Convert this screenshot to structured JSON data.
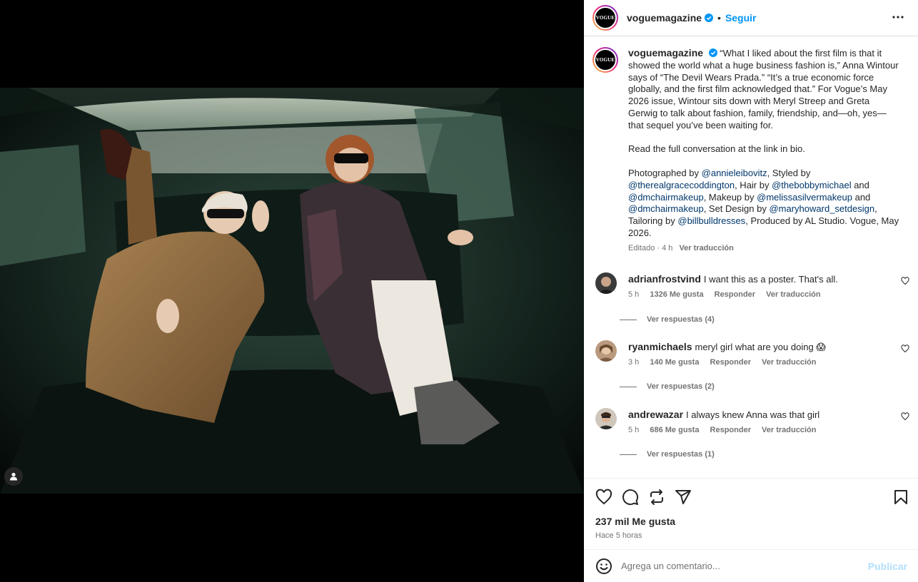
{
  "post": {
    "username": "voguemagazine",
    "avatar_text": "VOGUE",
    "follow_label": "Seguir",
    "separator": "•"
  },
  "caption": {
    "username": "voguemagazine",
    "p1": "“What I liked about the first film is that it showed the world what a huge business fashion is,” Anna Wintour says of “The Devil Wears Prada.” “It’s a true economic force globally, and the first film acknowledged that.” For Vogue’s May 2026 issue, Wintour sits down with Meryl Streep and Greta Gerwig to talk about fashion, family, friendship, and—oh, yes—that sequel you’ve been waiting for.",
    "p2": "Read the full conversation at the link in bio.",
    "p3": {
      "t1": "Photographed by ",
      "m1": "@annieleibovitz",
      "t2": ", Styled by ",
      "m2": "@therealgracecoddington",
      "t3": ", Hair by ",
      "m3": "@thebobbymichael",
      "t4": " and ",
      "m4": "@dmchairmakeup",
      "t5": ", Makeup by ",
      "m5": "@melissasilvermakeup",
      "t6": " and ",
      "m6": "@dmchairmakeup",
      "t7": ", Set Design by ",
      "m7": "@maryhoward_setdesign",
      "t8": ", Tailoring by ",
      "m8": "@billbulldresses",
      "t9": ", Produced by AL Studio. Vogue, May 2026."
    },
    "meta": "Editado · 4 h",
    "translate": "Ver traducción"
  },
  "comments": [
    {
      "username": "adrianfrostvind",
      "text": "I want this as a poster. That's all.",
      "time": "5 h",
      "likes": "1326 Me gusta",
      "reply": "Responder",
      "translate": "Ver traducción",
      "replies": "Ver respuestas (4)"
    },
    {
      "username": "ryanmichaels",
      "text": "meryl girl what are you doing 😱",
      "time": "3 h",
      "likes": "140 Me gusta",
      "reply": "Responder",
      "translate": "Ver traducción",
      "replies": "Ver respuestas (2)"
    },
    {
      "username": "andrewazar",
      "text": "I always knew Anna was that girl",
      "time": "5 h",
      "likes": "686 Me gusta",
      "reply": "Responder",
      "translate": "Ver traducción",
      "replies": "Ver respuestas (1)"
    }
  ],
  "actions": {
    "likes": "237 mil Me gusta",
    "time": "Hace 5 horas"
  },
  "compose": {
    "placeholder": "Agrega un comentario...",
    "publish": "Publicar"
  },
  "icons": [
    "person-tag-icon",
    "verified-badge-icon",
    "more-options-icon",
    "heart-icon",
    "comment-icon",
    "repost-icon",
    "share-icon",
    "bookmark-icon",
    "emoji-icon"
  ],
  "colors": {
    "accent": "#0095f6",
    "mention": "#00376b",
    "publish_disabled": "#b2dffc"
  }
}
